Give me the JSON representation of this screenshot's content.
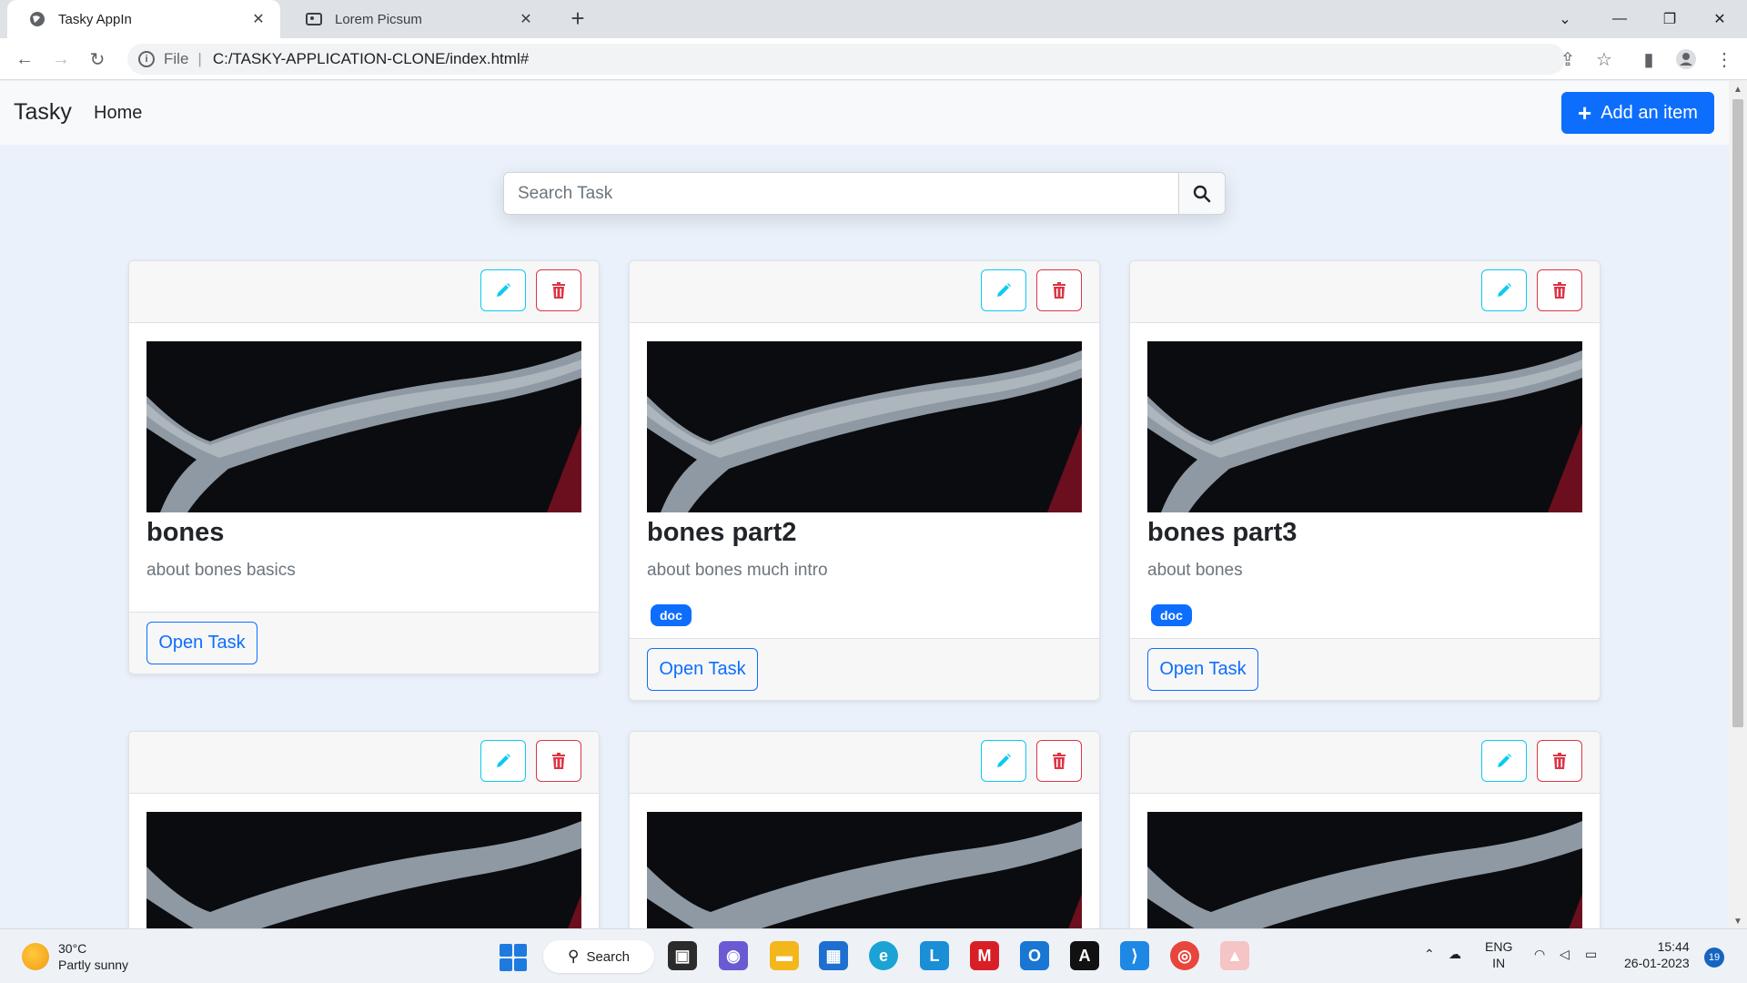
{
  "browser": {
    "tabs": [
      {
        "label": "Tasky AppIn",
        "active": true
      },
      {
        "label": "Lorem Picsum",
        "active": false
      }
    ],
    "new_tab_label": "+",
    "address": {
      "scheme_label": "File",
      "separator": "|",
      "url": "C:/TASKY-APPLICATION-CLONE/index.html#"
    }
  },
  "navbar": {
    "brand": "Tasky",
    "home_link": "Home",
    "add_button": "Add an item"
  },
  "search": {
    "placeholder": "Search Task"
  },
  "cards": [
    {
      "title": "bones",
      "description": "about bones basics",
      "tag": "",
      "button": "Open Task"
    },
    {
      "title": "bones part2",
      "description": "about bones much intro",
      "tag": "doc",
      "button": "Open Task"
    },
    {
      "title": "bones part3",
      "description": "about bones",
      "tag": "doc",
      "button": "Open Task"
    },
    {
      "title": "",
      "description": "",
      "tag": "",
      "button": ""
    },
    {
      "title": "",
      "description": "",
      "tag": "",
      "button": ""
    },
    {
      "title": "",
      "description": "",
      "tag": "",
      "button": ""
    }
  ],
  "taskbar": {
    "weather": {
      "temp": "30°C",
      "condition": "Partly sunny"
    },
    "search_label": "Search",
    "language": {
      "line1": "ENG",
      "line2": "IN"
    },
    "clock": {
      "time": "15:44",
      "date": "26-01-2023"
    },
    "notification_count": "19"
  },
  "colors": {
    "primary": "#0d6efd",
    "info": "#0dcaf0",
    "danger": "#dc3545",
    "page_bg": "#eaf1fb"
  }
}
